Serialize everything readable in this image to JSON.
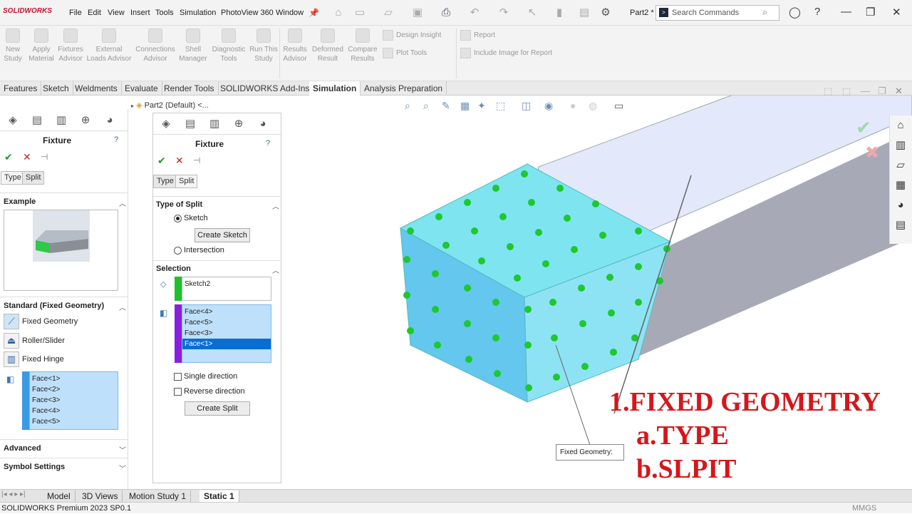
{
  "app": {
    "logo": "SOLIDWORKS",
    "part_name": "Part2 *",
    "search_placeholder": "Search Commands"
  },
  "menu": [
    "File",
    "Edit",
    "View",
    "Insert",
    "Tools",
    "Simulation",
    "PhotoView 360",
    "Window"
  ],
  "commands": [
    {
      "label": "New Study"
    },
    {
      "label": "Apply Material"
    },
    {
      "label": "Fixtures Advisor"
    },
    {
      "label": "External Loads Advisor"
    },
    {
      "label": "Connections Advisor"
    },
    {
      "label": "Shell Manager"
    },
    {
      "label": "Diagnostic Tools"
    },
    {
      "label": "Run This Study"
    },
    {
      "label": "Results Advisor"
    },
    {
      "label": "Deformed Result"
    },
    {
      "label": "Compare Results"
    }
  ],
  "side_commands": {
    "design_insight": "Design Insight",
    "plot_tools": "Plot Tools",
    "report": "Report",
    "include_image": "Include Image for Report"
  },
  "tabs": [
    "Features",
    "Sketch",
    "Weldments",
    "Evaluate",
    "Render Tools",
    "SOLIDWORKS Add-Ins",
    "Simulation",
    "Analysis Preparation"
  ],
  "left_panel": {
    "title": "Fixture",
    "type_tab": "Type",
    "split_tab": "Split",
    "example_label": "Example",
    "standard_label": "Standard (Fixed Geometry)",
    "options": [
      "Fixed Geometry",
      "Roller/Slider",
      "Fixed Hinge"
    ],
    "faces": [
      "Face<1>",
      "Face<2>",
      "Face<3>",
      "Face<4>",
      "Face<5>"
    ],
    "advanced": "Advanced",
    "symbol_settings": "Symbol Settings"
  },
  "tree": {
    "part": "Part2 (Default) <..."
  },
  "mid_panel": {
    "title": "Fixture",
    "type_tab": "Type",
    "split_tab": "Split",
    "type_of_split": "Type of Split",
    "sketch_radio": "Sketch",
    "create_sketch": "Create Sketch",
    "intersection_radio": "Intersection",
    "selection": "Selection",
    "sketch_item": "Sketch2",
    "faces": [
      "Face<4>",
      "Face<5>",
      "Face<3>",
      "Face<1>"
    ],
    "single_direction": "Single direction",
    "reverse_direction": "Reverse direction",
    "create_split": "Create Split"
  },
  "viewport": {
    "callout": "Fixed Geometry:"
  },
  "overlay": {
    "line1": "1.FIXED GEOMETRY",
    "line2": "a.TYPE",
    "line3": "b.SLPIT"
  },
  "bottom_tabs": [
    "Model",
    "3D Views",
    "Motion Study 1",
    "Static 1"
  ],
  "status": {
    "left": "SOLIDWORKS Premium 2023 SP0.1",
    "right": "MMGS"
  },
  "colors": {
    "accent": "#0a6dd4",
    "overlay": "#d4171b",
    "part_face": "#8ef0f5",
    "fixture": "#22cc22"
  }
}
